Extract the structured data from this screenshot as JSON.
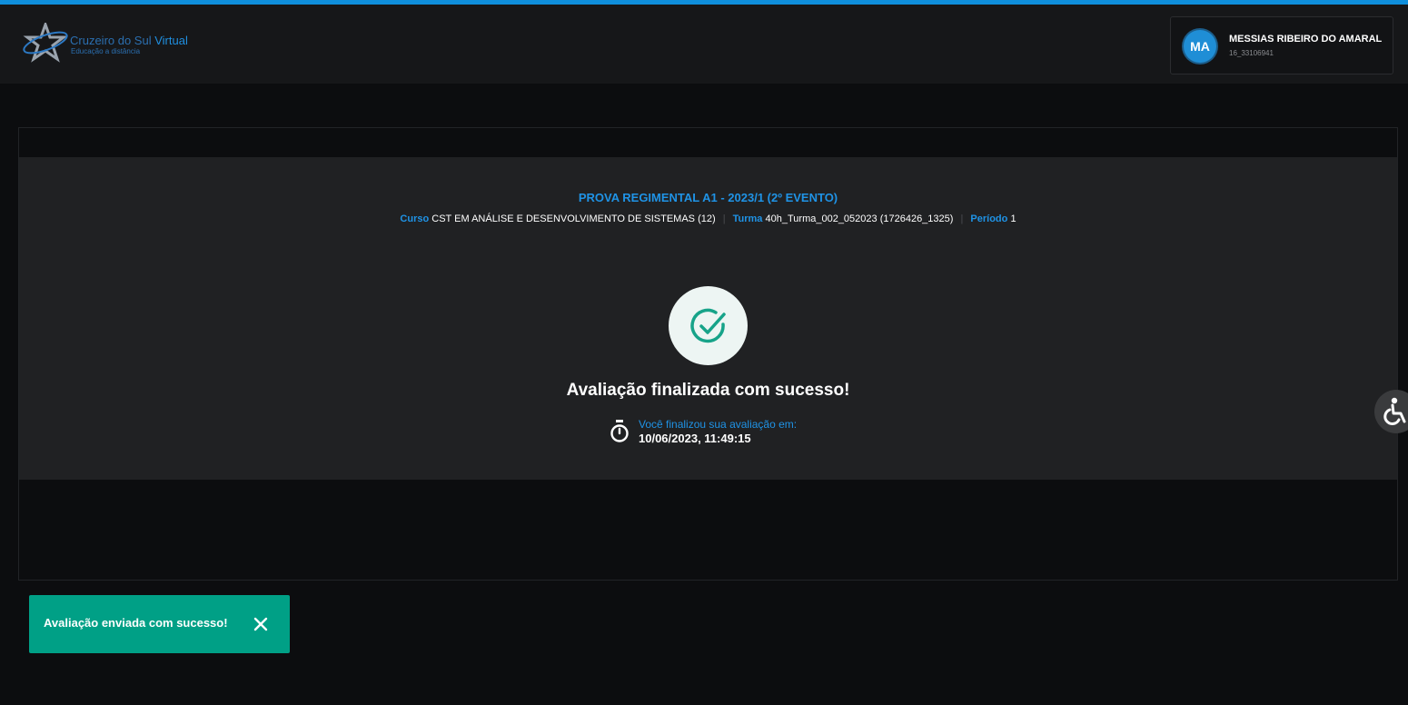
{
  "header": {
    "logo": {
      "brand_main": "Cruzeiro do Sul",
      "brand_accent": "Virtual",
      "tagline": "Educação a distância"
    },
    "user": {
      "initials": "MA",
      "name": "MESSIAS RIBEIRO DO AMARAL",
      "id": "16_33106941"
    }
  },
  "exam": {
    "title": "PROVA REGIMENTAL A1 - 2023/1 (2º EVENTO)",
    "course_label": "Curso",
    "course_value": "CST EM ANÁLISE E DESENVOLVIMENTO DE SISTEMAS (12)",
    "class_label": "Turma",
    "class_value": "40h_Turma_002_052023 (1726426_1325)",
    "period_label": "Período",
    "period_value": "1",
    "separator": "|"
  },
  "result": {
    "heading": "Avaliação finalizada com sucesso!",
    "finished_label": "Você finalizou sua avaliação em:",
    "finished_time": "10/06/2023, 11:49:15"
  },
  "toast": {
    "message": "Avaliação enviada com sucesso!"
  },
  "colors": {
    "accent_blue": "#1f93e6",
    "success_green": "#00a086",
    "check_green": "#17a389"
  },
  "icons": {
    "check": "check-circle-icon",
    "stopwatch": "stopwatch-icon",
    "close": "close-icon",
    "accessibility": "accessibility-icon"
  }
}
